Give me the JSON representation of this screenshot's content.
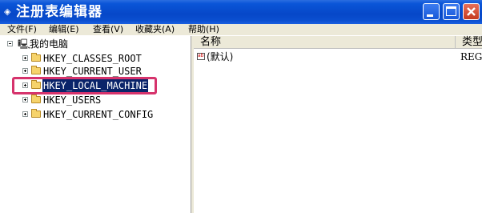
{
  "window": {
    "title": "注册表编辑器"
  },
  "menu": [
    "文件(F)",
    "编辑(E)",
    "查看(V)",
    "收藏夹(A)",
    "帮助(H)"
  ],
  "tree": {
    "root": "我的电脑",
    "keys": [
      "HKEY_CLASSES_ROOT",
      "HKEY_CURRENT_USER",
      "HKEY_LOCAL_MACHINE",
      "HKEY_USERS",
      "HKEY_CURRENT_CONFIG"
    ],
    "selected_key": "HKEY_LOCAL_MACHINE"
  },
  "list": {
    "columns": [
      "名称",
      "类型"
    ],
    "rows": [
      {
        "name": "(默认)",
        "type": "REG"
      }
    ]
  },
  "colors": {
    "title_bar": "#0a55d8",
    "selection": "#0a246a",
    "annotation_box": "#d6336c"
  }
}
